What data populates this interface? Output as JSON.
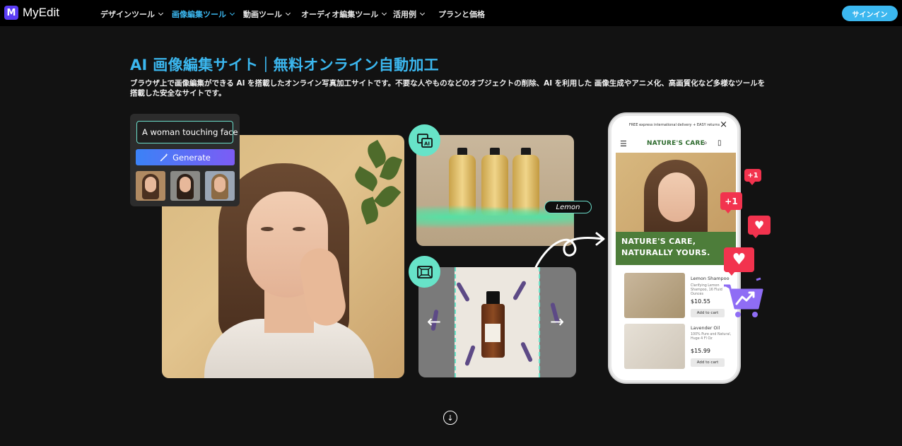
{
  "nav": {
    "logo_text": "MyEdit",
    "logo_mark": "M",
    "items": [
      {
        "label": "デザインツール",
        "dropdown": true,
        "active": false
      },
      {
        "label": "画像編集ツール",
        "dropdown": true,
        "active": true
      },
      {
        "label": "動画ツール",
        "dropdown": true,
        "active": false
      },
      {
        "label": "オーディオ編集ツール",
        "dropdown": true,
        "active": false
      },
      {
        "label": "活用例",
        "dropdown": true,
        "active": false
      },
      {
        "label": "プランと価格",
        "dropdown": false,
        "active": false
      }
    ],
    "signin_label": "サインイン"
  },
  "hero": {
    "title": "AI 画像編集サイト｜無料オンライン自動加工",
    "description": "ブラウザ上で画像編集ができる AI を搭載したオンライン写真加工サイトです。不要な人やものなどのオブジェクトの削除、AI を利用した 画像生成やアニメ化、高画質化など多様なツールを搭載した安全なサイトです。"
  },
  "prompt_panel": {
    "input_value": "A woman touching face",
    "generate_label": "Generate",
    "generate_icon": "magic-wand-icon"
  },
  "product_card": {
    "tag": "Lemon",
    "badge_icon": "ai-image-icon"
  },
  "expand_card": {
    "badge_icon": "expand-icon",
    "left_arrow": "←",
    "right_arrow": "→"
  },
  "phone": {
    "notice": "FREE express international delivery + EASY returns",
    "close": "×",
    "menu_icon": "☰",
    "brand": "NATURE'S CARE",
    "search_icon": "⌕",
    "bag_icon": "▯",
    "banner_line1": "NATURE'S CARE,",
    "banner_line2": "NATURALLY YOURS.",
    "products": [
      {
        "name": "Lemon Shampoo",
        "desc": "Clarifying Lemon Shampoo, 16 Fluid Ounces",
        "price": "$10.55",
        "cart": "Add to cart"
      },
      {
        "name": "Lavender Oil",
        "desc": "100% Pure and Natural, Huge 4 Fl Oz",
        "price": "$15.99",
        "cart": "Add to cart"
      }
    ]
  },
  "notifications": [
    {
      "type": "plus",
      "text": "+1"
    },
    {
      "type": "plus",
      "text": "+1"
    },
    {
      "type": "heart",
      "text": "♥"
    },
    {
      "type": "heart",
      "text": "♥"
    }
  ],
  "scroll_down_icon": "↓",
  "colors": {
    "accent": "#3bb7ef",
    "teal": "#67e3c8",
    "generate_from": "#3b82f6",
    "generate_to": "#7c5cf5",
    "notification": "#f2334e",
    "brand_green": "#4d7d3a",
    "background": "#121212"
  }
}
